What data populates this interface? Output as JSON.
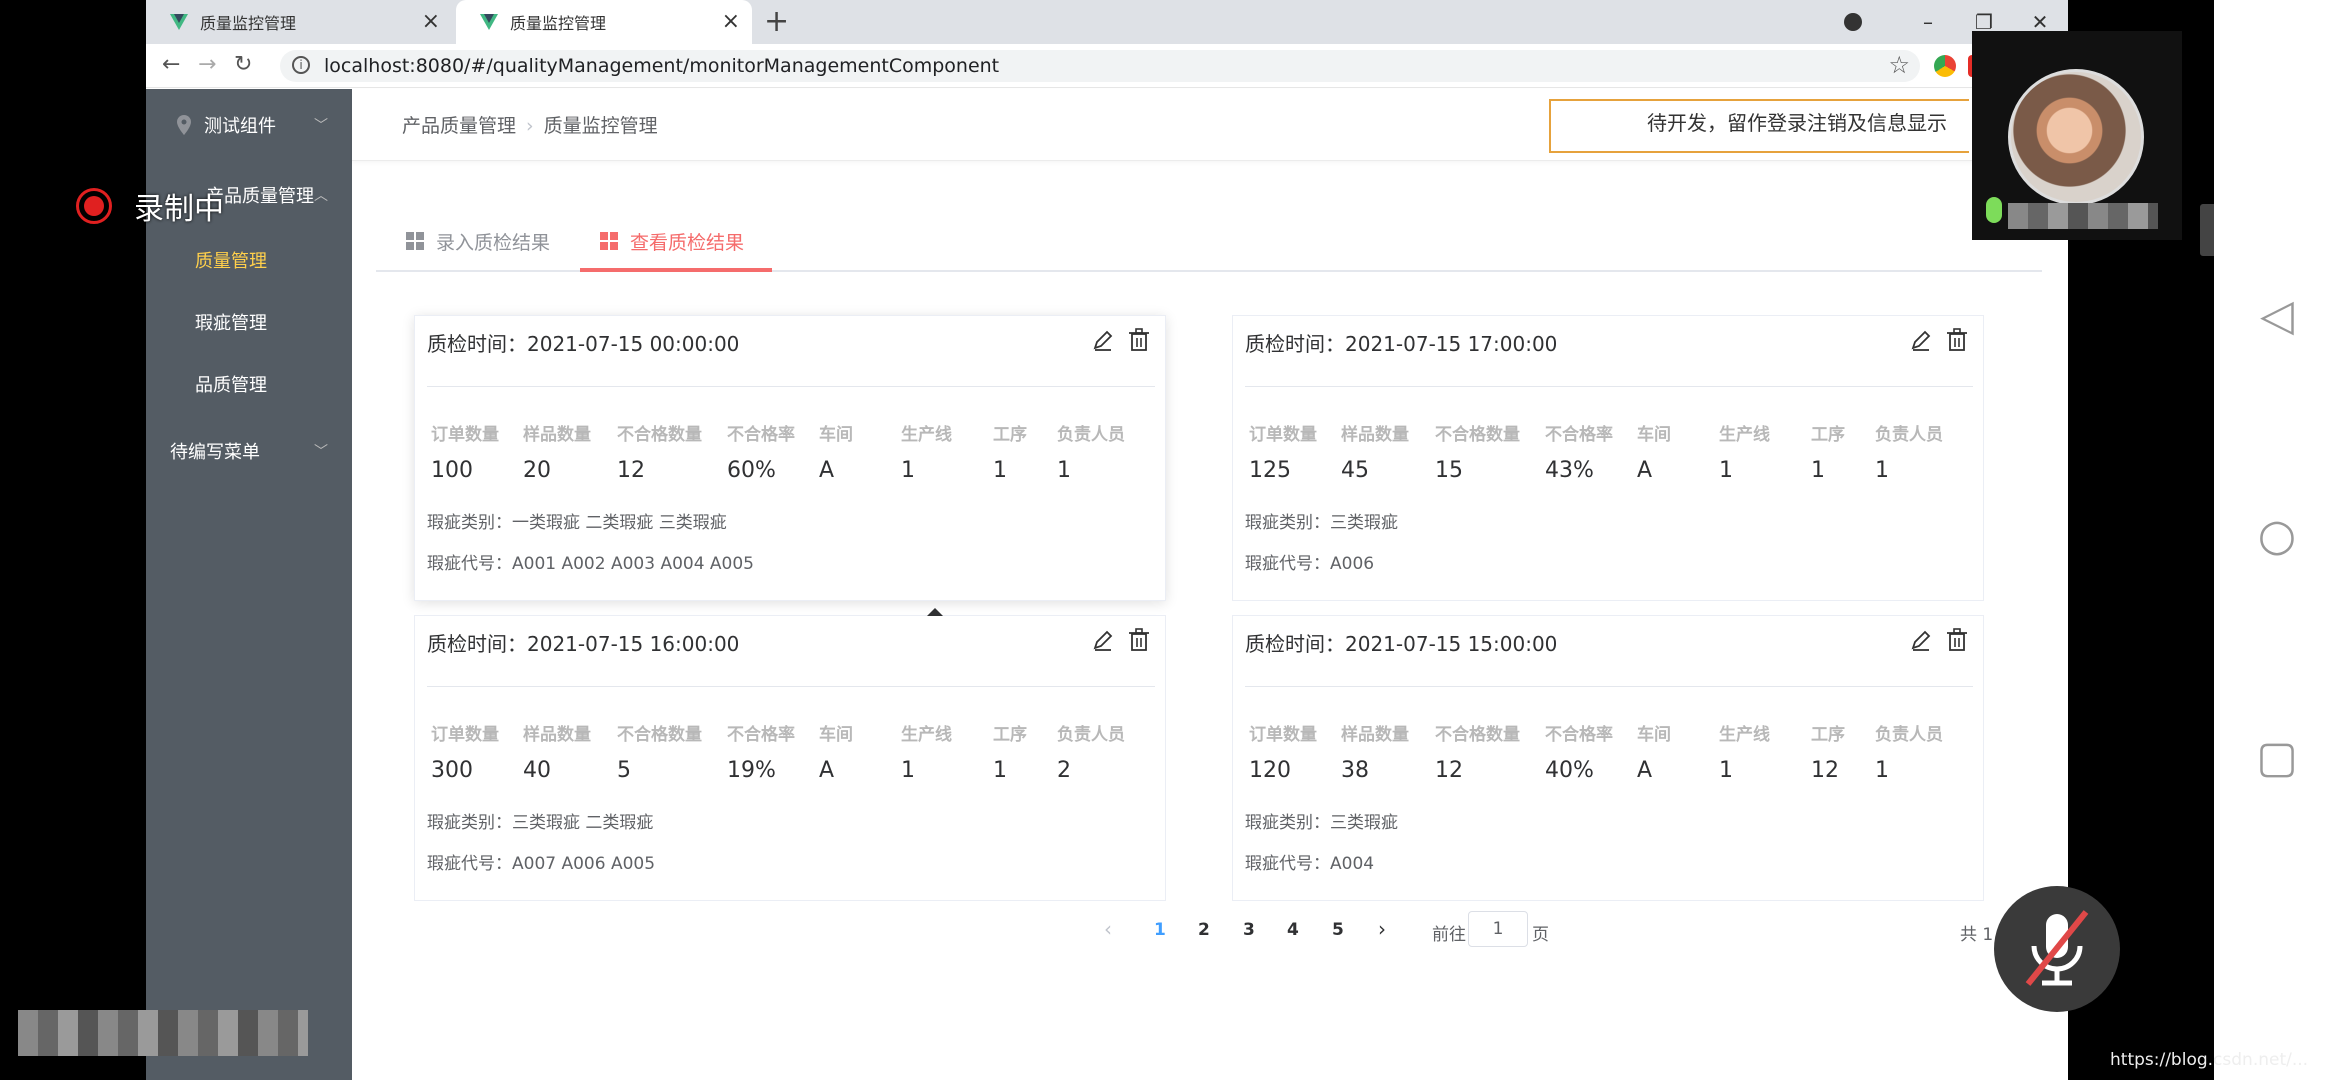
{
  "browser": {
    "tabs": [
      {
        "title": "质量监控管理"
      },
      {
        "title": "质量监控管理"
      }
    ],
    "url": "localhost:8080/#/qualityManagement/monitorManagementComponent"
  },
  "sidebar": {
    "items": [
      {
        "label": "测试组件"
      },
      {
        "label": "产品质量管理"
      },
      {
        "label": "待编写菜单"
      }
    ],
    "subitems": [
      {
        "label": "质量管理",
        "active": true
      },
      {
        "label": "瑕疵管理"
      },
      {
        "label": "品质管理"
      }
    ]
  },
  "header": {
    "breadcrumb": [
      "产品质量管理",
      "质量监控管理"
    ],
    "notice": "待开发，留作登录注销及信息显示"
  },
  "page_tabs": [
    {
      "label": "录入质检结果"
    },
    {
      "label": "查看质检结果",
      "active": true
    }
  ],
  "column_headers": [
    "订单数量",
    "样品数量",
    "不合格数量",
    "不合格率",
    "车间",
    "生产线",
    "工序",
    "负责人员"
  ],
  "cards": [
    {
      "title": "质检时间：2021-07-15 00:00:00",
      "values": [
        "100",
        "20",
        "12",
        "60%",
        "A",
        "1",
        "1",
        "1"
      ],
      "defect_types": "瑕疵类别：一类瑕疵 二类瑕疵 三类瑕疵",
      "defect_codes": "瑕疵代号：A001 A002 A003 A004 A005"
    },
    {
      "title": "质检时间：2021-07-15 17:00:00",
      "values": [
        "125",
        "45",
        "15",
        "43%",
        "A",
        "1",
        "1",
        "1"
      ],
      "defect_types": "瑕疵类别：三类瑕疵",
      "defect_codes": "瑕疵代号：A006"
    },
    {
      "title": "质检时间：2021-07-15 16:00:00",
      "values": [
        "300",
        "40",
        "5",
        "19%",
        "A",
        "1",
        "1",
        "2"
      ],
      "defect_types": "瑕疵类别：三类瑕疵 二类瑕疵",
      "defect_codes": "瑕疵代号：A007 A006 A005"
    },
    {
      "title": "质检时间：2021-07-15 15:00:00",
      "values": [
        "120",
        "38",
        "12",
        "40%",
        "A",
        "1",
        "12",
        "1"
      ],
      "defect_types": "瑕疵类别：三类瑕疵",
      "defect_codes": "瑕疵代号：A004"
    }
  ],
  "pagination": {
    "pages": [
      "1",
      "2",
      "3",
      "4",
      "5"
    ],
    "current": "1",
    "goto_label": "前往",
    "goto_value": "1",
    "page_suffix": "页",
    "total": "共 1 条"
  },
  "overlay": {
    "recording_label": "录制中",
    "watermark": "https://blog.csdn.net/...",
    "record_color": "#e02020"
  },
  "colors": {
    "sidebar_bg": "#545c64",
    "active_menu": "#ffd04b",
    "tab_active": "#f56c6c",
    "page_active": "#409eff",
    "notice_border": "#e6a23c"
  }
}
